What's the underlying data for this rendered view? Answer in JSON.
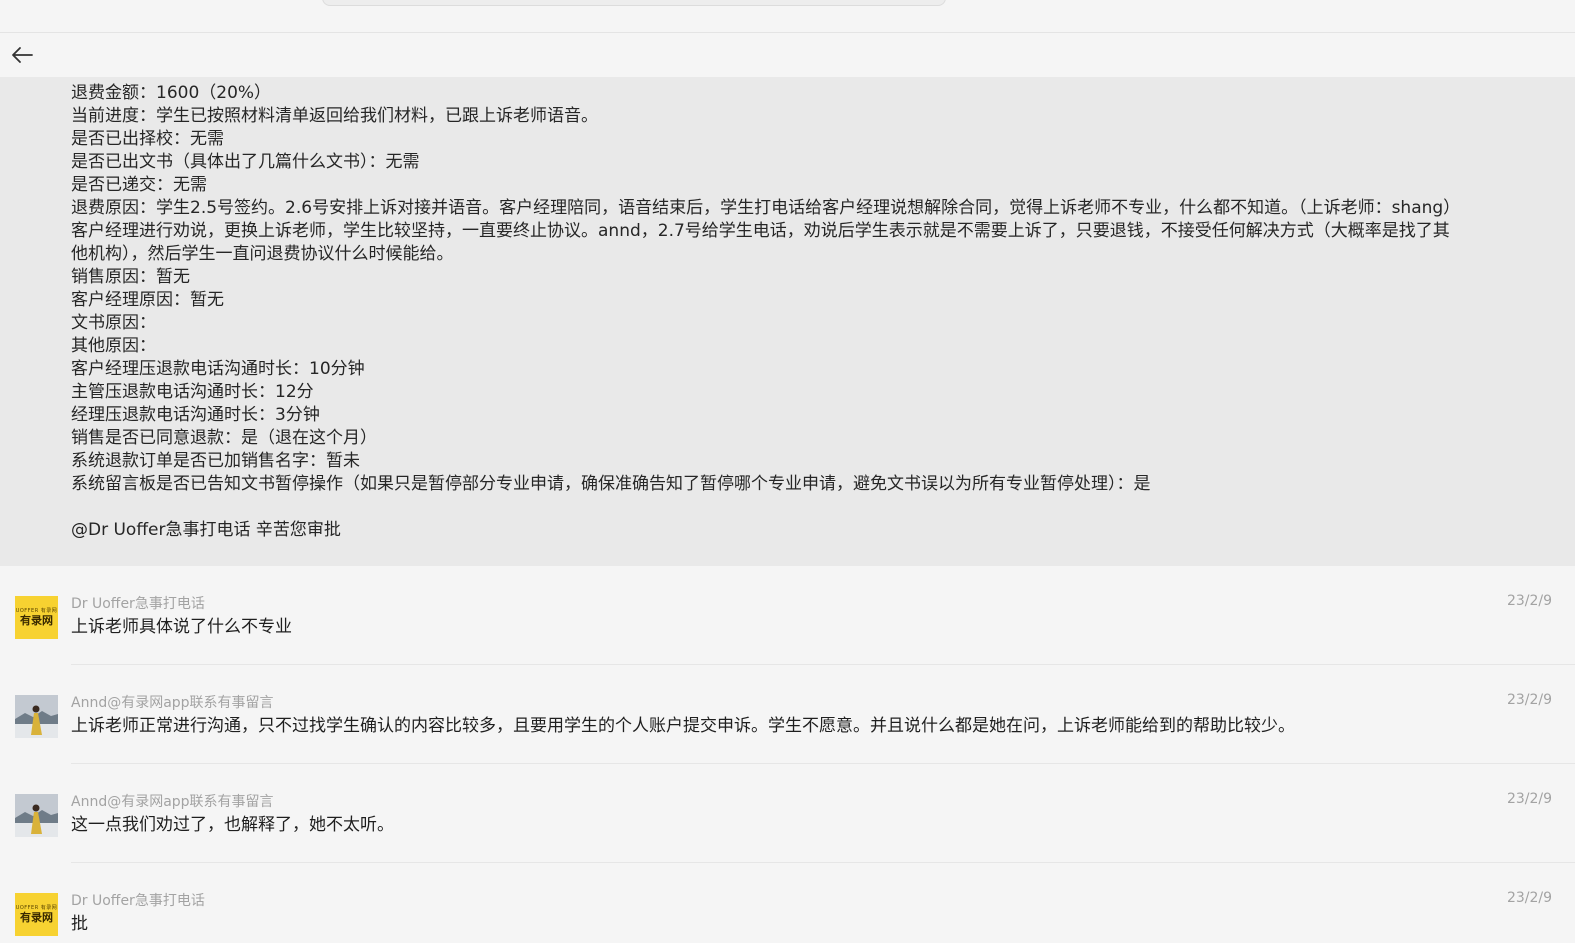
{
  "header": {
    "back_icon": "arrow-left-icon"
  },
  "quoted": {
    "lines": [
      "退费金额：1600（20%）",
      "当前进度：学生已按照材料清单返回给我们材料，已跟上诉老师语音。",
      "是否已出择校：无需",
      "是否已出文书（具体出了几篇什么文书）：无需",
      "是否已递交：无需",
      "退费原因：学生2.5号签约。2.6号安排上诉对接并语音。客户经理陪同，语音结束后，学生打电话给客户经理说想解除合同，觉得上诉老师不专业，什么都不知道。（上诉老师：shang）客户经理进行劝说，更换上诉老师，学生比较坚持，一直要终止协议。annd，2.7号给学生电话，劝说后学生表示就是不需要上诉了，只要退钱，不接受任何解决方式（大概率是找了其他机构），然后学生一直问退费协议什么时候能给。",
      "销售原因：暂无",
      "客户经理原因：暂无",
      "文书原因：",
      "其他原因：",
      "客户经理压退款电话沟通时长：10分钟",
      "主管压退款电话沟通时长：12分",
      "经理压退款电话沟通时长：3分钟",
      "销售是否已同意退款：是（退在这个月）",
      "系统退款订单是否已加销售名字：暂未",
      "系统留言板是否已告知文书暂停操作（如果只是暂停部分专业申请，确保准确告知了暂停哪个专业申请，避免文书误以为所有专业暂停处理）：是",
      "",
      "@Dr Uoffer急事打电话 辛苦您审批"
    ]
  },
  "messages": [
    {
      "sender": "Dr Uoffer急事打电话",
      "date": "23/2/9",
      "text": "上诉老师具体说了什么不专业",
      "avatar": "logo",
      "logo_small": "UOFFER 有录网",
      "logo_text": "有录网"
    },
    {
      "sender": "Annd@有录网app联系有事留言",
      "date": "23/2/9",
      "text": "上诉老师正常进行沟通，只不过找学生确认的内容比较多，且要用学生的个人账户提交申诉。学生不愿意。并且说什么都是她在问，上诉老师能给到的帮助比较少。",
      "avatar": "photo"
    },
    {
      "sender": "Annd@有录网app联系有事留言",
      "date": "23/2/9",
      "text": "这一点我们劝过了，也解释了，她不太听。",
      "avatar": "photo"
    },
    {
      "sender": "Dr Uoffer急事打电话",
      "date": "23/2/9",
      "text": "批",
      "avatar": "logo",
      "logo_small": "UOFFER 有录网",
      "logo_text": "有录网"
    }
  ]
}
